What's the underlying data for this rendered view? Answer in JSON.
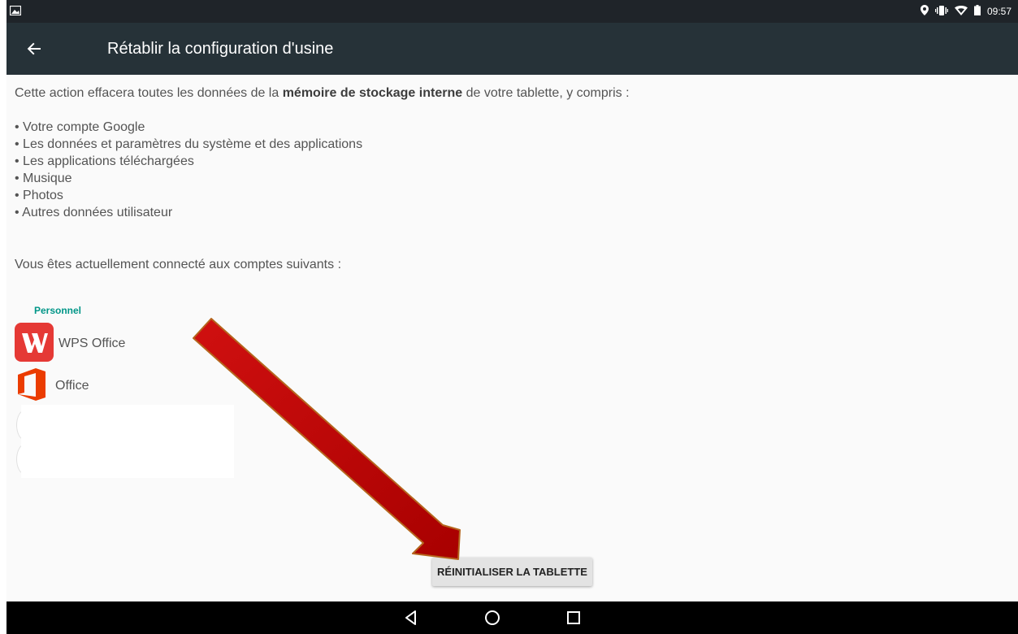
{
  "statusbar": {
    "time": "09:57"
  },
  "toolbar": {
    "title": "Rétablir la configuration d'usine"
  },
  "content": {
    "intro_before": "Cette action effacera toutes les données de la ",
    "intro_bold": "mémoire de stockage interne",
    "intro_after": " de votre tablette, y compris :",
    "bullets": [
      "• Votre compte Google",
      "• Les données et paramètres du système et des applications",
      "• Les applications téléchargées",
      "• Musique",
      "• Photos",
      "• Autres données utilisateur"
    ],
    "accounts_intro": "Vous êtes actuellement connecté aux comptes suivants :",
    "section_label": "Personnel",
    "accounts": [
      {
        "label": "WPS Office",
        "icon": "wps-office-icon",
        "color": "#e53935"
      },
      {
        "label": "Office",
        "icon": "microsoft-office-icon",
        "color": "#eb3c00"
      }
    ]
  },
  "reset_button": {
    "label": "RÉINITIALISER LA TABLETTE"
  },
  "colors": {
    "toolbar": "#263238",
    "statusbar": "#1f2429",
    "accent": "#009688",
    "annotation_arrow": "#c00000"
  }
}
